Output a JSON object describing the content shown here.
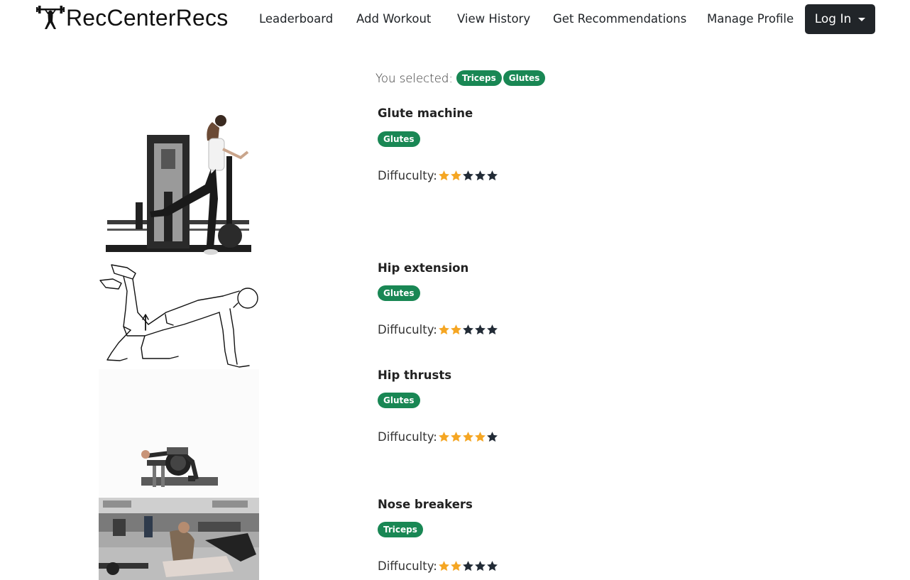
{
  "nav": {
    "brand": "RecCenterRecs",
    "brand_icon": "weightlifter-icon",
    "links": [
      "Leaderboard",
      "Add Workout",
      "View History",
      "Get Recommendations",
      "Manage Profile"
    ],
    "login_label": "Log In"
  },
  "selection": {
    "label": "You selected:",
    "tags": [
      "Triceps",
      "Glutes"
    ]
  },
  "exercises": [
    {
      "name": "Glute machine",
      "tag": "Glutes",
      "difficulty_label": "Diffuculty:",
      "difficulty": 2,
      "max": 5
    },
    {
      "name": "Hip extension",
      "tag": "Glutes",
      "difficulty_label": "Diffuculty:",
      "difficulty": 2,
      "max": 5
    },
    {
      "name": "Hip thrusts",
      "tag": "Glutes",
      "difficulty_label": "Diffuculty:",
      "difficulty": 4,
      "max": 5
    },
    {
      "name": "Nose breakers",
      "tag": "Triceps",
      "difficulty_label": "Diffuculty:",
      "difficulty": 2,
      "max": 5
    }
  ],
  "colors": {
    "badge": "#198754",
    "star_filled": "#f5a623",
    "star_empty": "#222b36",
    "navbar_button": "#212529"
  }
}
